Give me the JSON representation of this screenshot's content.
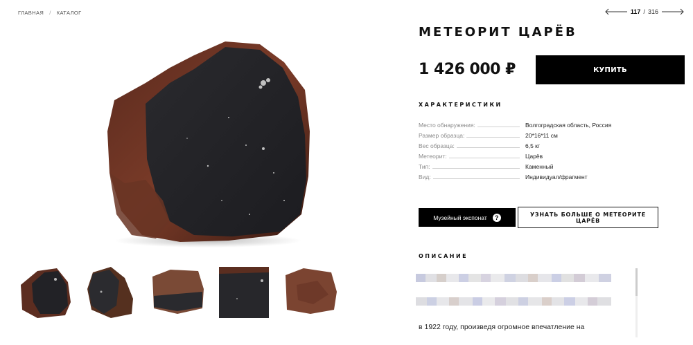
{
  "breadcrumb": {
    "home": "ГЛАВНАЯ",
    "separator": "/",
    "catalog": "КАТАЛОГ"
  },
  "pager": {
    "current": "117",
    "separator": "/",
    "total": "316"
  },
  "product": {
    "title": "МЕТЕОРИТ ЦАРЁВ",
    "price": "1 426 000 ₽",
    "buy_label": "КУПИТЬ"
  },
  "specs": {
    "heading": "ХАРАКТЕРИСТИКИ",
    "rows": [
      {
        "label": "Место обнаружения:",
        "value": "Волгоградская область, Россия"
      },
      {
        "label": "Размер образца:",
        "value": "20*16*11 см"
      },
      {
        "label": "Вес образца:",
        "value": "6,5 кг"
      },
      {
        "label": "Метеорит:",
        "value": "Царёв"
      },
      {
        "label": "Тип:",
        "value": "Каменный"
      },
      {
        "label": "Вид:",
        "value": "Индивидуал/фрагмент"
      }
    ]
  },
  "actions": {
    "museum_label": "Музейный экспонат",
    "help_glyph": "?",
    "more_label": "УЗНАТЬ БОЛЬШЕ О МЕТЕОРИТЕ ЦАРЁВ"
  },
  "description": {
    "heading": "ОПИСАНИЕ",
    "visible_text": "в 1922 году, произведя огромное впечатление на"
  },
  "icons": {
    "pager_prev": "arrow-left-icon",
    "pager_next": "arrow-right-icon",
    "help": "question-icon"
  },
  "colors": {
    "accent": "#000000",
    "text": "#111111",
    "muted": "#8a8a8a"
  }
}
